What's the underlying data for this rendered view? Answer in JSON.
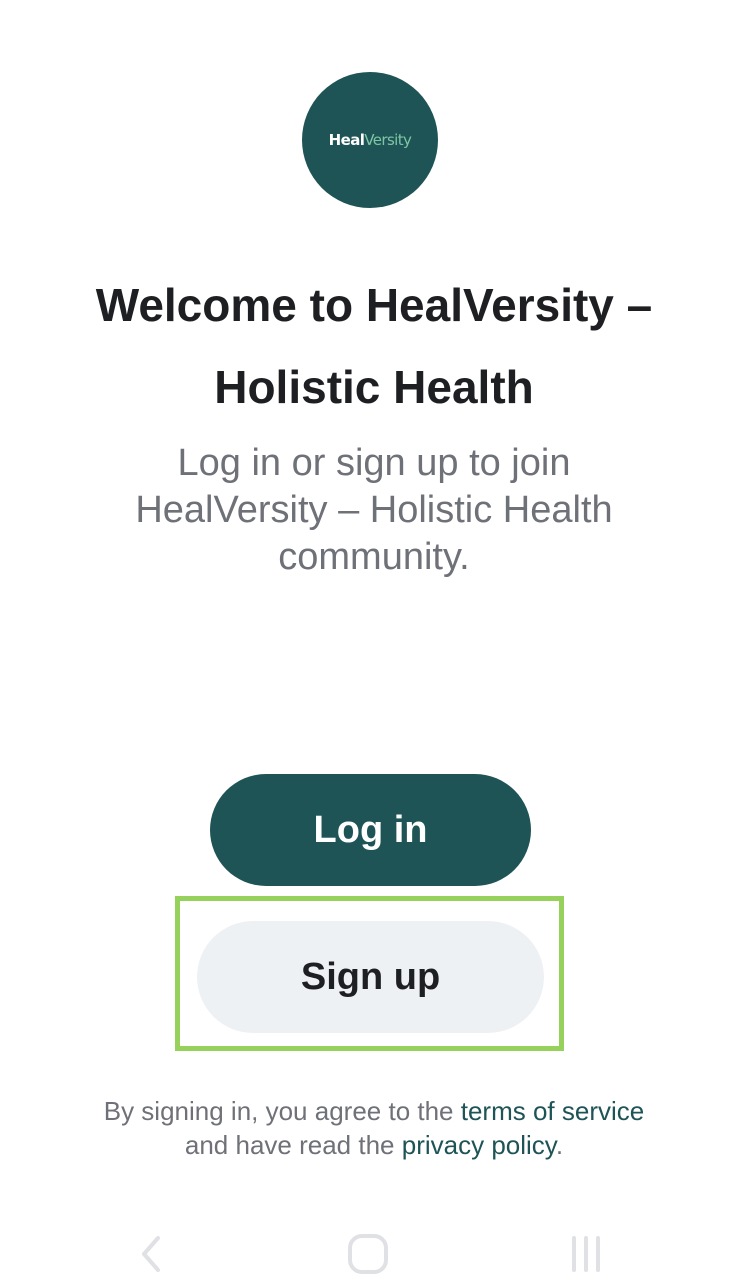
{
  "logo": {
    "text_bold": "Heal",
    "text_light": "Versity"
  },
  "welcome": {
    "title": "Welcome to HealVersity – Holistic Health",
    "subtitle": "Log in or sign up to join HealVersity – Holistic Health community."
  },
  "buttons": {
    "login_label": "Log in",
    "signup_label": "Sign up"
  },
  "legal": {
    "prefix": "By signing in, you agree to the",
    "terms_link": "terms of service",
    "middle": "and have read the",
    "privacy_link": "privacy policy",
    "suffix": "."
  },
  "navbar": {
    "icons": [
      "back-icon",
      "home-icon",
      "recent-apps-icon"
    ]
  },
  "colors": {
    "brand": "#1f5456",
    "highlight": "#96d15c",
    "secondary_button": "#eef1f4"
  }
}
